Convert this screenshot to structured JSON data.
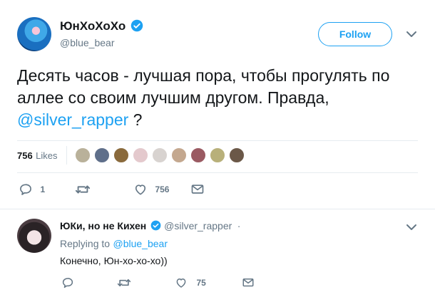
{
  "main_tweet": {
    "author_name": "ЮнХоХоХо",
    "author_handle": "@blue_bear",
    "follow_label": "Follow",
    "text_part1": "Десять часов - лучшая пора, чтобы прогулять по аллее со своим лучшим другом. Правда, ",
    "mention": "@silver_rapper",
    "text_part2": " ?",
    "likes_count": "756",
    "likes_label": "Likes",
    "actions": {
      "reply_count": "1",
      "like_count": "756"
    }
  },
  "reply_tweet": {
    "author_name": "ЮКи, но не Кихен",
    "author_handle": "@silver_rapper",
    "dot": "·",
    "replying_to_label": "Replying to",
    "replying_to_handle": "@blue_bear",
    "text": "Конечно, Юн-хо-хо-хо))",
    "actions": {
      "like_count": "75"
    }
  },
  "colors": {
    "accent": "#1da1f2",
    "muted": "#657786",
    "border": "#e6ecf0"
  }
}
